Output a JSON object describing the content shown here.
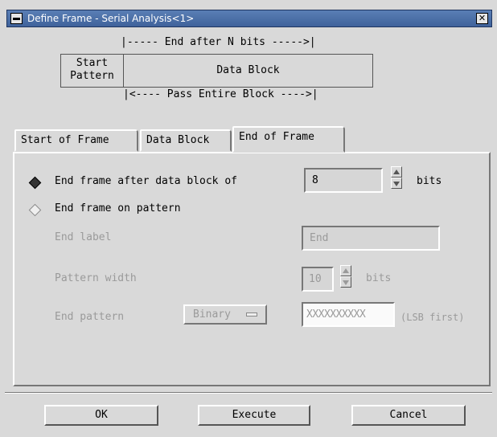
{
  "window": {
    "title": "Define Frame - Serial Analysis<1>",
    "close_glyph": "✕"
  },
  "diagram": {
    "end_after_n_bits": "|----- End after N bits ----->|",
    "start_pattern": [
      "Start",
      "Pattern"
    ],
    "data_block": "Data Block",
    "pass_entire_block": "|<---- Pass Entire Block ---->|"
  },
  "tabs": [
    {
      "label": "Start of Frame",
      "active": false
    },
    {
      "label": "Data Block",
      "active": false
    },
    {
      "label": "End of Frame",
      "active": true
    }
  ],
  "panel": {
    "end_after_block": {
      "label": "End frame after data block of",
      "value": "8",
      "unit": "bits",
      "selected": true
    },
    "end_on_pattern": {
      "label": "End frame on pattern",
      "selected": false
    },
    "end_label": {
      "label": "End label",
      "value": "End"
    },
    "pattern_width": {
      "label": "Pattern width",
      "value": "10",
      "unit": "bits"
    },
    "end_pattern": {
      "label": "End pattern",
      "format": "Binary",
      "value": "XXXXXXXXXX",
      "note": "(LSB first)"
    }
  },
  "buttons": {
    "ok": "OK",
    "execute": "Execute",
    "cancel": "Cancel"
  },
  "icons": {
    "window_menu": "window-menu-icon",
    "close": "close-icon",
    "spin_up": "arrow-up-icon",
    "spin_down": "arrow-down-icon"
  }
}
